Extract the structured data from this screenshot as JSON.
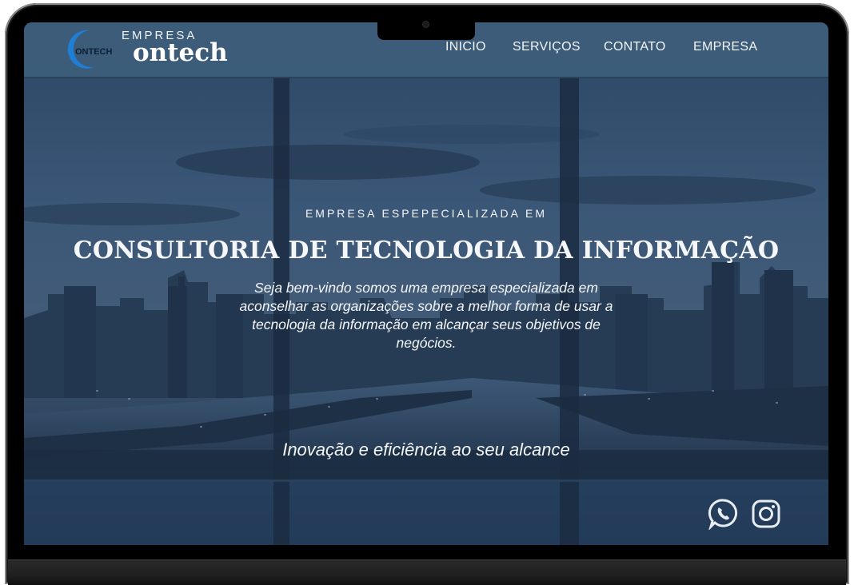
{
  "brand": {
    "top": "EMPRESA",
    "name": "ontech",
    "logo_text": "ONTECH"
  },
  "nav": {
    "items": [
      "INICIO",
      "SERVIÇOS",
      "CONTATO",
      "EMPRESA"
    ]
  },
  "hero": {
    "kicker": "EMPRESA ESPEPECIALIZADA EM",
    "headline": "CONSULTORIA DE TECNOLOGIA DA INFORMAÇÃO",
    "description": "Seja bem-vindo somos uma empresa especializada em aconselhar as organizações sobre a melhor forma de usar a tecnologia da informação em alcançar seus objetivos de negócios.",
    "tagline": "Inovação e eficiência ao seu alcance"
  },
  "social": {
    "icons": [
      "whatsapp-icon",
      "instagram-icon"
    ]
  },
  "colors": {
    "header": "#3e5e7b",
    "overlay": "#1e3550",
    "text": "#f4f6f8",
    "logo_accent": "#1e7fd6"
  }
}
